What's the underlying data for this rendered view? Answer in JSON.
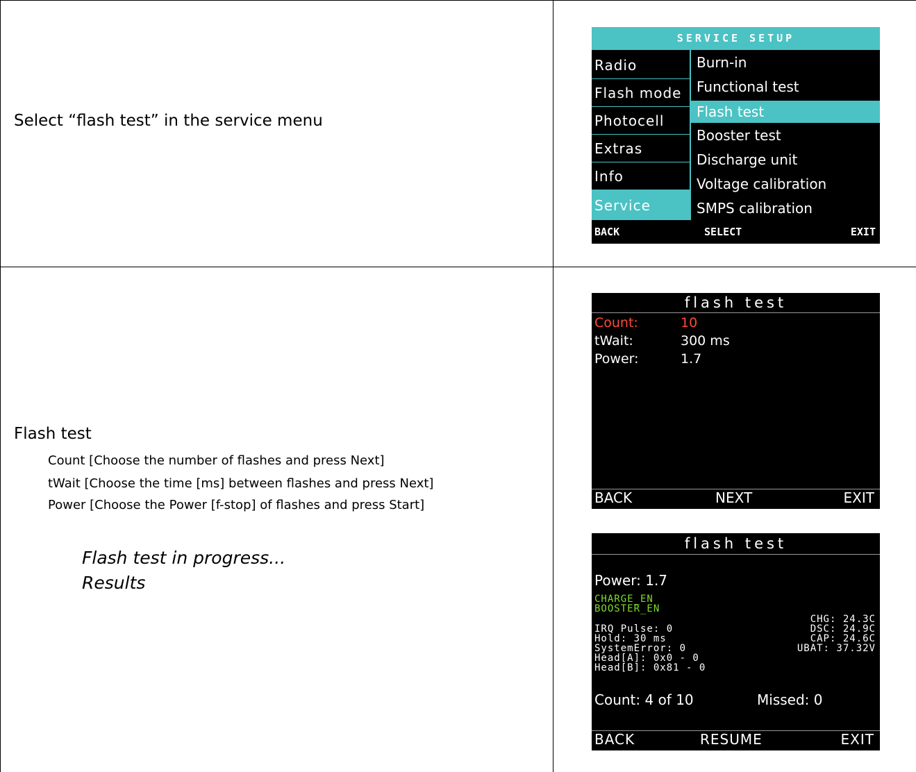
{
  "rows": [
    {
      "description": "Select “flash test” in the service menu"
    },
    {
      "title": "Flash test",
      "steps": [
        "Count [Choose the number of flashes and press Next]",
        "tWait [Choose the time [ms] between flashes and press Next]",
        "Power [Choose the Power [f-stop] of flashes and press Start]"
      ],
      "notes": [
        "Flash test in progress...",
        "Results"
      ]
    }
  ],
  "service_setup": {
    "title": "SERVICE SETUP",
    "left_menu": [
      "Radio",
      "Flash mode",
      "Photocell",
      "Extras",
      "Info",
      "Service"
    ],
    "left_selected": 5,
    "right_menu": [
      "Burn-in",
      "Functional test",
      "Flash test",
      "Booster test",
      "Discharge unit",
      "Voltage calibration",
      "SMPS calibration"
    ],
    "right_selected": 2,
    "footer": {
      "back": "BACK",
      "select": "SELECT",
      "exit": "EXIT"
    }
  },
  "flash_test_setup": {
    "title": "flash test",
    "fields": [
      {
        "label": "Count:",
        "value": "10",
        "active": true
      },
      {
        "label": "tWait:",
        "value": "300 ms",
        "active": false
      },
      {
        "label": "Power:",
        "value": "1.7",
        "active": false
      }
    ],
    "footer": {
      "back": "BACK",
      "next": "NEXT",
      "exit": "EXIT"
    }
  },
  "flash_test_progress": {
    "title": "flash test",
    "power": "Power: 1.7",
    "flags": [
      "CHARGE_EN",
      "BOOSTER_EN"
    ],
    "status_left": [
      "IRQ Pulse: 0",
      "Hold: 30 ms",
      "SystemError: 0",
      "Head[A]: 0x0 - 0",
      "Head[B]: 0x81 - 0"
    ],
    "status_right": [
      "CHG: 24.3C",
      "DSC: 24.9C",
      "CAP: 24.6C",
      "UBAT: 37.32V"
    ],
    "count": "Count: 4 of 10",
    "missed": "Missed: 0",
    "footer": {
      "back": "BACK",
      "resume": "RESUME",
      "exit": "EXIT"
    }
  },
  "colors": {
    "teal": "#4bc2c3",
    "active_field": "#ff4a3a",
    "flag_green": "#7fdc2a"
  }
}
